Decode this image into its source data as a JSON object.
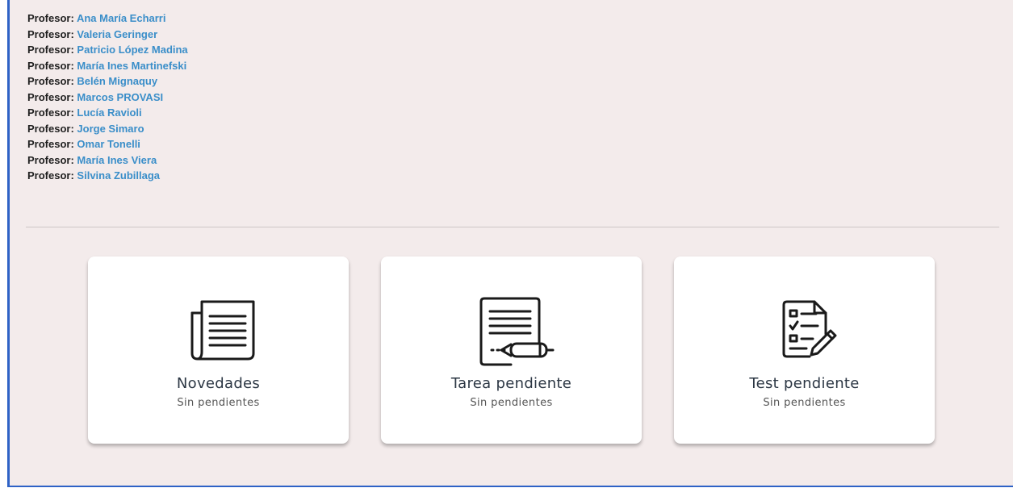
{
  "teachers": {
    "role_label": "Profesor:",
    "names": [
      "Ana María Echarri",
      "Valeria Geringer",
      "Patricio López Madina",
      "María Ines Martinefski",
      "Belén Mignaquy",
      "Marcos PROVASI",
      "Lucía Ravioli",
      "Jorge Simaro",
      "Omar Tonelli",
      "María Ines Viera",
      "Silvina Zubillaga"
    ]
  },
  "cards": [
    {
      "title": "Novedades",
      "subtitle": "Sin pendientes",
      "icon": "newspaper-icon"
    },
    {
      "title": "Tarea pendiente",
      "subtitle": "Sin pendientes",
      "icon": "document-pen-icon"
    },
    {
      "title": "Test pendiente",
      "subtitle": "Sin pendientes",
      "icon": "checklist-icon"
    }
  ],
  "colors": {
    "accent_border": "#2e62c6",
    "teacher_name": "#3a8ec9",
    "background": "#f3ebeb"
  }
}
